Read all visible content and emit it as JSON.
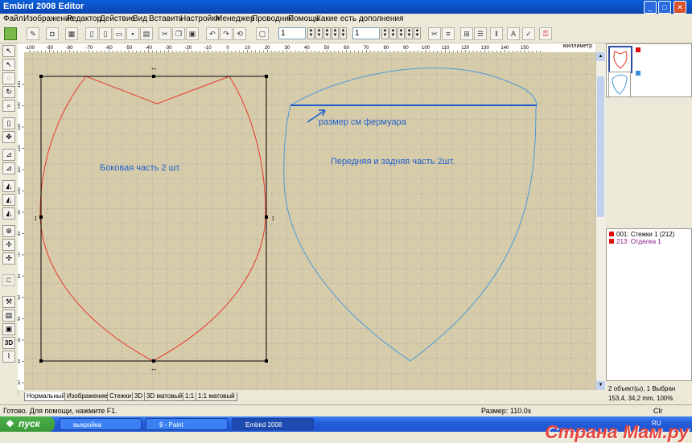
{
  "window": {
    "title": "Embird 2008 Editor"
  },
  "menu": [
    "Файл",
    "Изображение",
    "Редактор",
    "Действие",
    "Вид",
    "Вставить",
    "Настройки",
    "Менеджер",
    "Проводник",
    "Помощь",
    "Какие есть дополнения"
  ],
  "toolbar": {
    "field1": "1",
    "field2": "1"
  },
  "ruler": {
    "h_labels": [
      "-100",
      "-90",
      "-80",
      "-70",
      "-60",
      "-50",
      "-40",
      "-30",
      "-20",
      "-10",
      "0",
      "10",
      "20",
      "30",
      "40",
      "50",
      "60",
      "70",
      "80",
      "90",
      "100",
      "110",
      "120",
      "130",
      "140",
      "150"
    ],
    "unit": "миллиметр",
    "v_labels": [
      "150",
      "140",
      "130",
      "120",
      "110",
      "100",
      "90",
      "80",
      "70",
      "60",
      "50",
      "40",
      "30",
      "20",
      "10",
      "0"
    ]
  },
  "canvas": {
    "label_left": "Боковая часть 2 шт.",
    "label_right": "Передняя и задняя часть 2шт.",
    "annotation": "размер см фермуара",
    "colors": {
      "background": "#d6ccaa",
      "left_shape": "#e8372a",
      "right_shape": "#4a9ad8",
      "annotation": "#1f5fcc"
    }
  },
  "objects": [
    {
      "id": "001:",
      "name": "Стежки 1 (212)",
      "color": "#e01010"
    },
    {
      "id": "213:",
      "name": "Отделка 1",
      "color": "#e01010"
    }
  ],
  "right_info": {
    "selection": "2 объект(ы), 1 Выбран",
    "coords": "153,4, 34,2 mm, 100%"
  },
  "tabs": [
    "Нормальный",
    "Изображение",
    "Стежки",
    "3D",
    "3D матовый",
    "1:1",
    "1:1 матовый"
  ],
  "status": {
    "left": "Готово. Для помощи, нажмите F1.",
    "size": "Размер: 110.0x",
    "right": "Clr"
  },
  "taskbar": {
    "start": "пуск",
    "tasks": [
      "выкройка",
      "9 - Paint",
      "Embird 2008"
    ],
    "lang": "RU",
    "watermark": "Страна Мам.ру"
  }
}
